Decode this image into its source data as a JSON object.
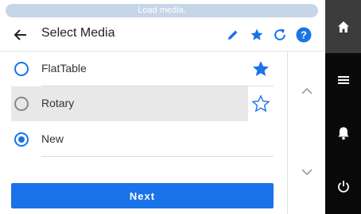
{
  "status": {
    "message": "Load media."
  },
  "header": {
    "title": "Select Media",
    "icons": [
      "back-arrow-icon",
      "pencil-icon",
      "star-icon",
      "refresh-icon",
      "help-icon"
    ]
  },
  "media_list": {
    "items": [
      {
        "label": "FlatTable",
        "selected": false,
        "favorite": true
      },
      {
        "label": "Rotary",
        "selected": false,
        "favorite": false,
        "highlighted": true
      },
      {
        "label": "New",
        "selected": true,
        "favorite": null
      }
    ]
  },
  "scroll": {
    "up_icon": "chevron-up-icon",
    "down_icon": "chevron-down-icon"
  },
  "actions": {
    "next_label": "Next"
  },
  "side_rail": {
    "items": [
      "home-icon",
      "menu-icon",
      "bell-icon",
      "power-icon"
    ],
    "active": "home-icon"
  },
  "colors": {
    "accent": "#1a73e8",
    "rail": "#0a0a0a",
    "rail_active": "#3c3c3c",
    "status_bar": "#c7d6e7"
  }
}
